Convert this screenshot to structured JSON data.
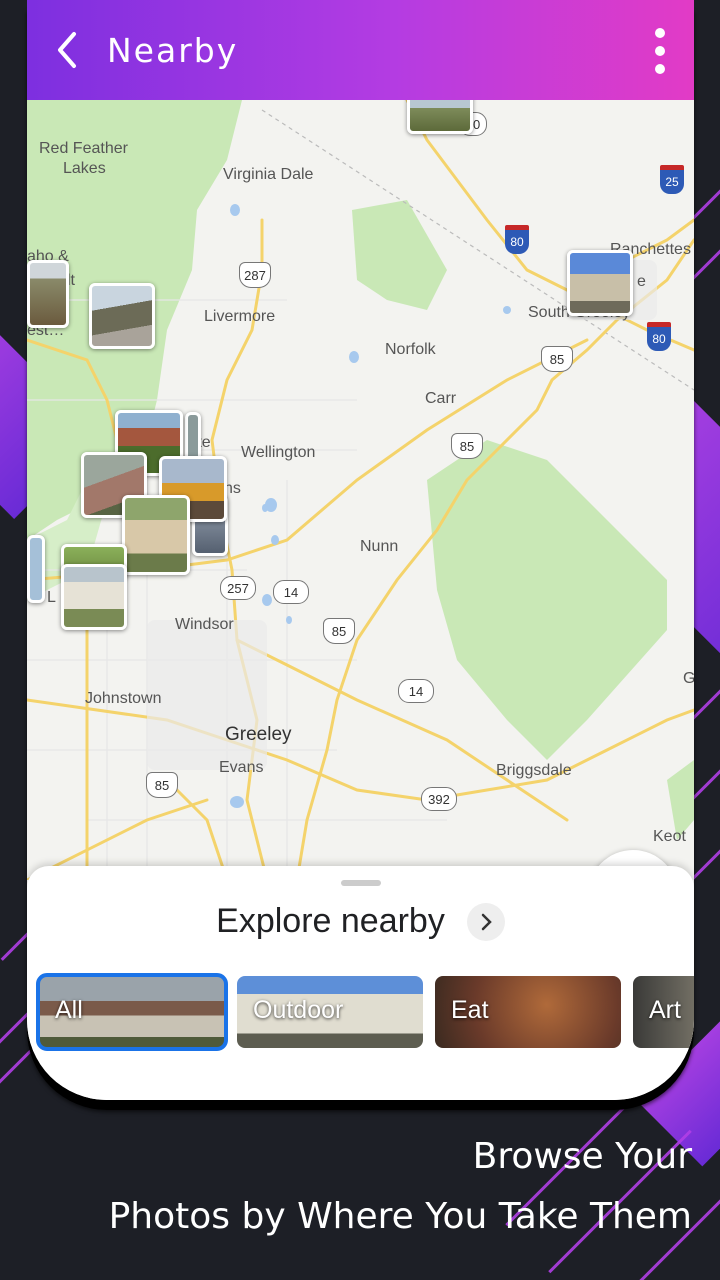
{
  "header": {
    "title": "Nearby",
    "back_icon": "chevron-left-icon",
    "menu_icon": "more-vertical-icon"
  },
  "colors": {
    "accent_start": "#7d2fe0",
    "accent_end": "#e23bc6",
    "selected_outline": "#1a73e8"
  },
  "map": {
    "places": [
      "Red Feather",
      "Lakes",
      "Virginia Dale",
      "Livermore",
      "Norfolk",
      "Carr",
      "Wellington",
      "Nunn",
      "Windsor",
      "Johnstown",
      "Greeley",
      "Evans",
      "Briggsdale",
      "Ranchettes",
      "South Greeley",
      "Keot",
      "G",
      "aho &",
      "lt",
      "l",
      "est…",
      "rte",
      "ns",
      "L"
    ],
    "highway_shields": [
      "287",
      "85",
      "85",
      "85",
      "257",
      "14",
      "14",
      "392",
      "85"
    ],
    "interstate_shields": [
      "25",
      "80",
      "80"
    ],
    "partial_shield": "10",
    "partial_place_cheyenne": "C",
    "partial_place_cheyenne_end": "e"
  },
  "locate_button": {
    "icon": "my-location-icon"
  },
  "sheet": {
    "title": "Explore nearby",
    "more_icon": "chevron-right-icon",
    "categories": [
      {
        "label": "All",
        "selected": true
      },
      {
        "label": "Outdoor",
        "selected": false
      },
      {
        "label": "Eat",
        "selected": false
      },
      {
        "label": "Art",
        "selected": false
      }
    ]
  },
  "caption": {
    "line1": "Browse Your",
    "line2": "Photos by Where You Take Them"
  }
}
